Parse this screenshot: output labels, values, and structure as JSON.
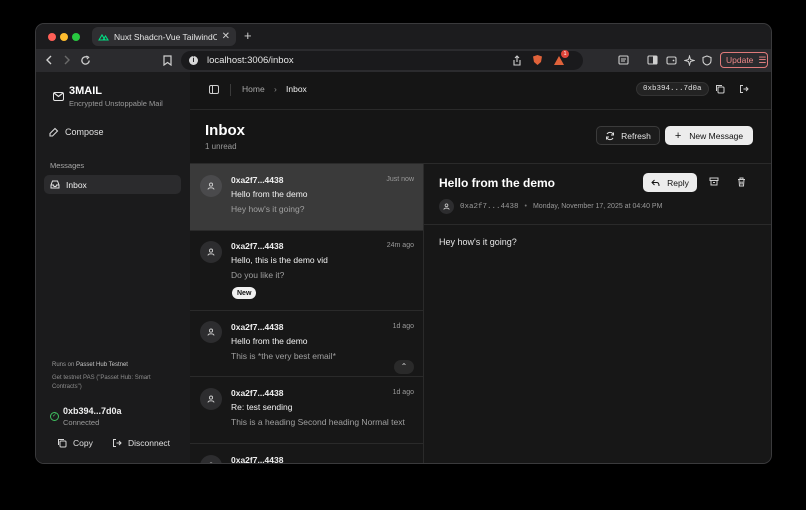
{
  "browser": {
    "tab_title": "Nuxt Shadcn-Vue TailwindCSS",
    "url": "localhost:3006/inbox",
    "update_label": "Update",
    "shield_badge": "1"
  },
  "sidebar": {
    "app_name": "3MAIL",
    "tagline": "Encrypted Unstoppable Mail",
    "compose_label": "Compose",
    "section_label": "Messages",
    "inbox_label": "Inbox",
    "runs_on_prefix": "Runs on",
    "network": "Passet Hub Testnet",
    "faucet_text": "Get testnet PAS (\"Passet Hub: Smart Contracts\")",
    "account_address": "0xb394...7d0a",
    "account_status": "Connected",
    "copy_label": "Copy",
    "disconnect_label": "Disconnect"
  },
  "header": {
    "breadcrumb_home": "Home",
    "breadcrumb_current": "Inbox",
    "address_pill": "0xb394...7d0a"
  },
  "inbox": {
    "title": "Inbox",
    "unread": "1 unread",
    "refresh_label": "Refresh",
    "new_message_label": "New Message"
  },
  "messages": [
    {
      "sender": "0xa2f7...4438",
      "time": "Just now",
      "subject": "Hello from the demo",
      "preview": "Hey how's it going?",
      "badge": ""
    },
    {
      "sender": "0xa2f7...4438",
      "time": "24m ago",
      "subject": "Hello, this is the demo vid",
      "preview": "Do you like it?",
      "badge": "New"
    },
    {
      "sender": "0xa2f7...4438",
      "time": "1d ago",
      "subject": "Hello from the demo",
      "preview": "This is *the very best email*",
      "badge": ""
    },
    {
      "sender": "0xa2f7...4438",
      "time": "1d ago",
      "subject": "Re: test sending",
      "preview": "This is a heading Second heading Normal text",
      "badge": ""
    },
    {
      "sender": "0xa2f7...4438",
      "time": "1d ago",
      "subject": "",
      "preview": "",
      "badge": ""
    }
  ],
  "reader": {
    "subject": "Hello from the demo",
    "reply_label": "Reply",
    "from": "0xa2f7...4438",
    "date": "Monday, November 17, 2025 at 04:40 PM",
    "body": "Hey how's it going?"
  },
  "colors": {
    "traffic_red": "#ff5f57",
    "traffic_yellow": "#febc2e",
    "traffic_green": "#28c840",
    "connected_green": "#3fbf5f"
  }
}
